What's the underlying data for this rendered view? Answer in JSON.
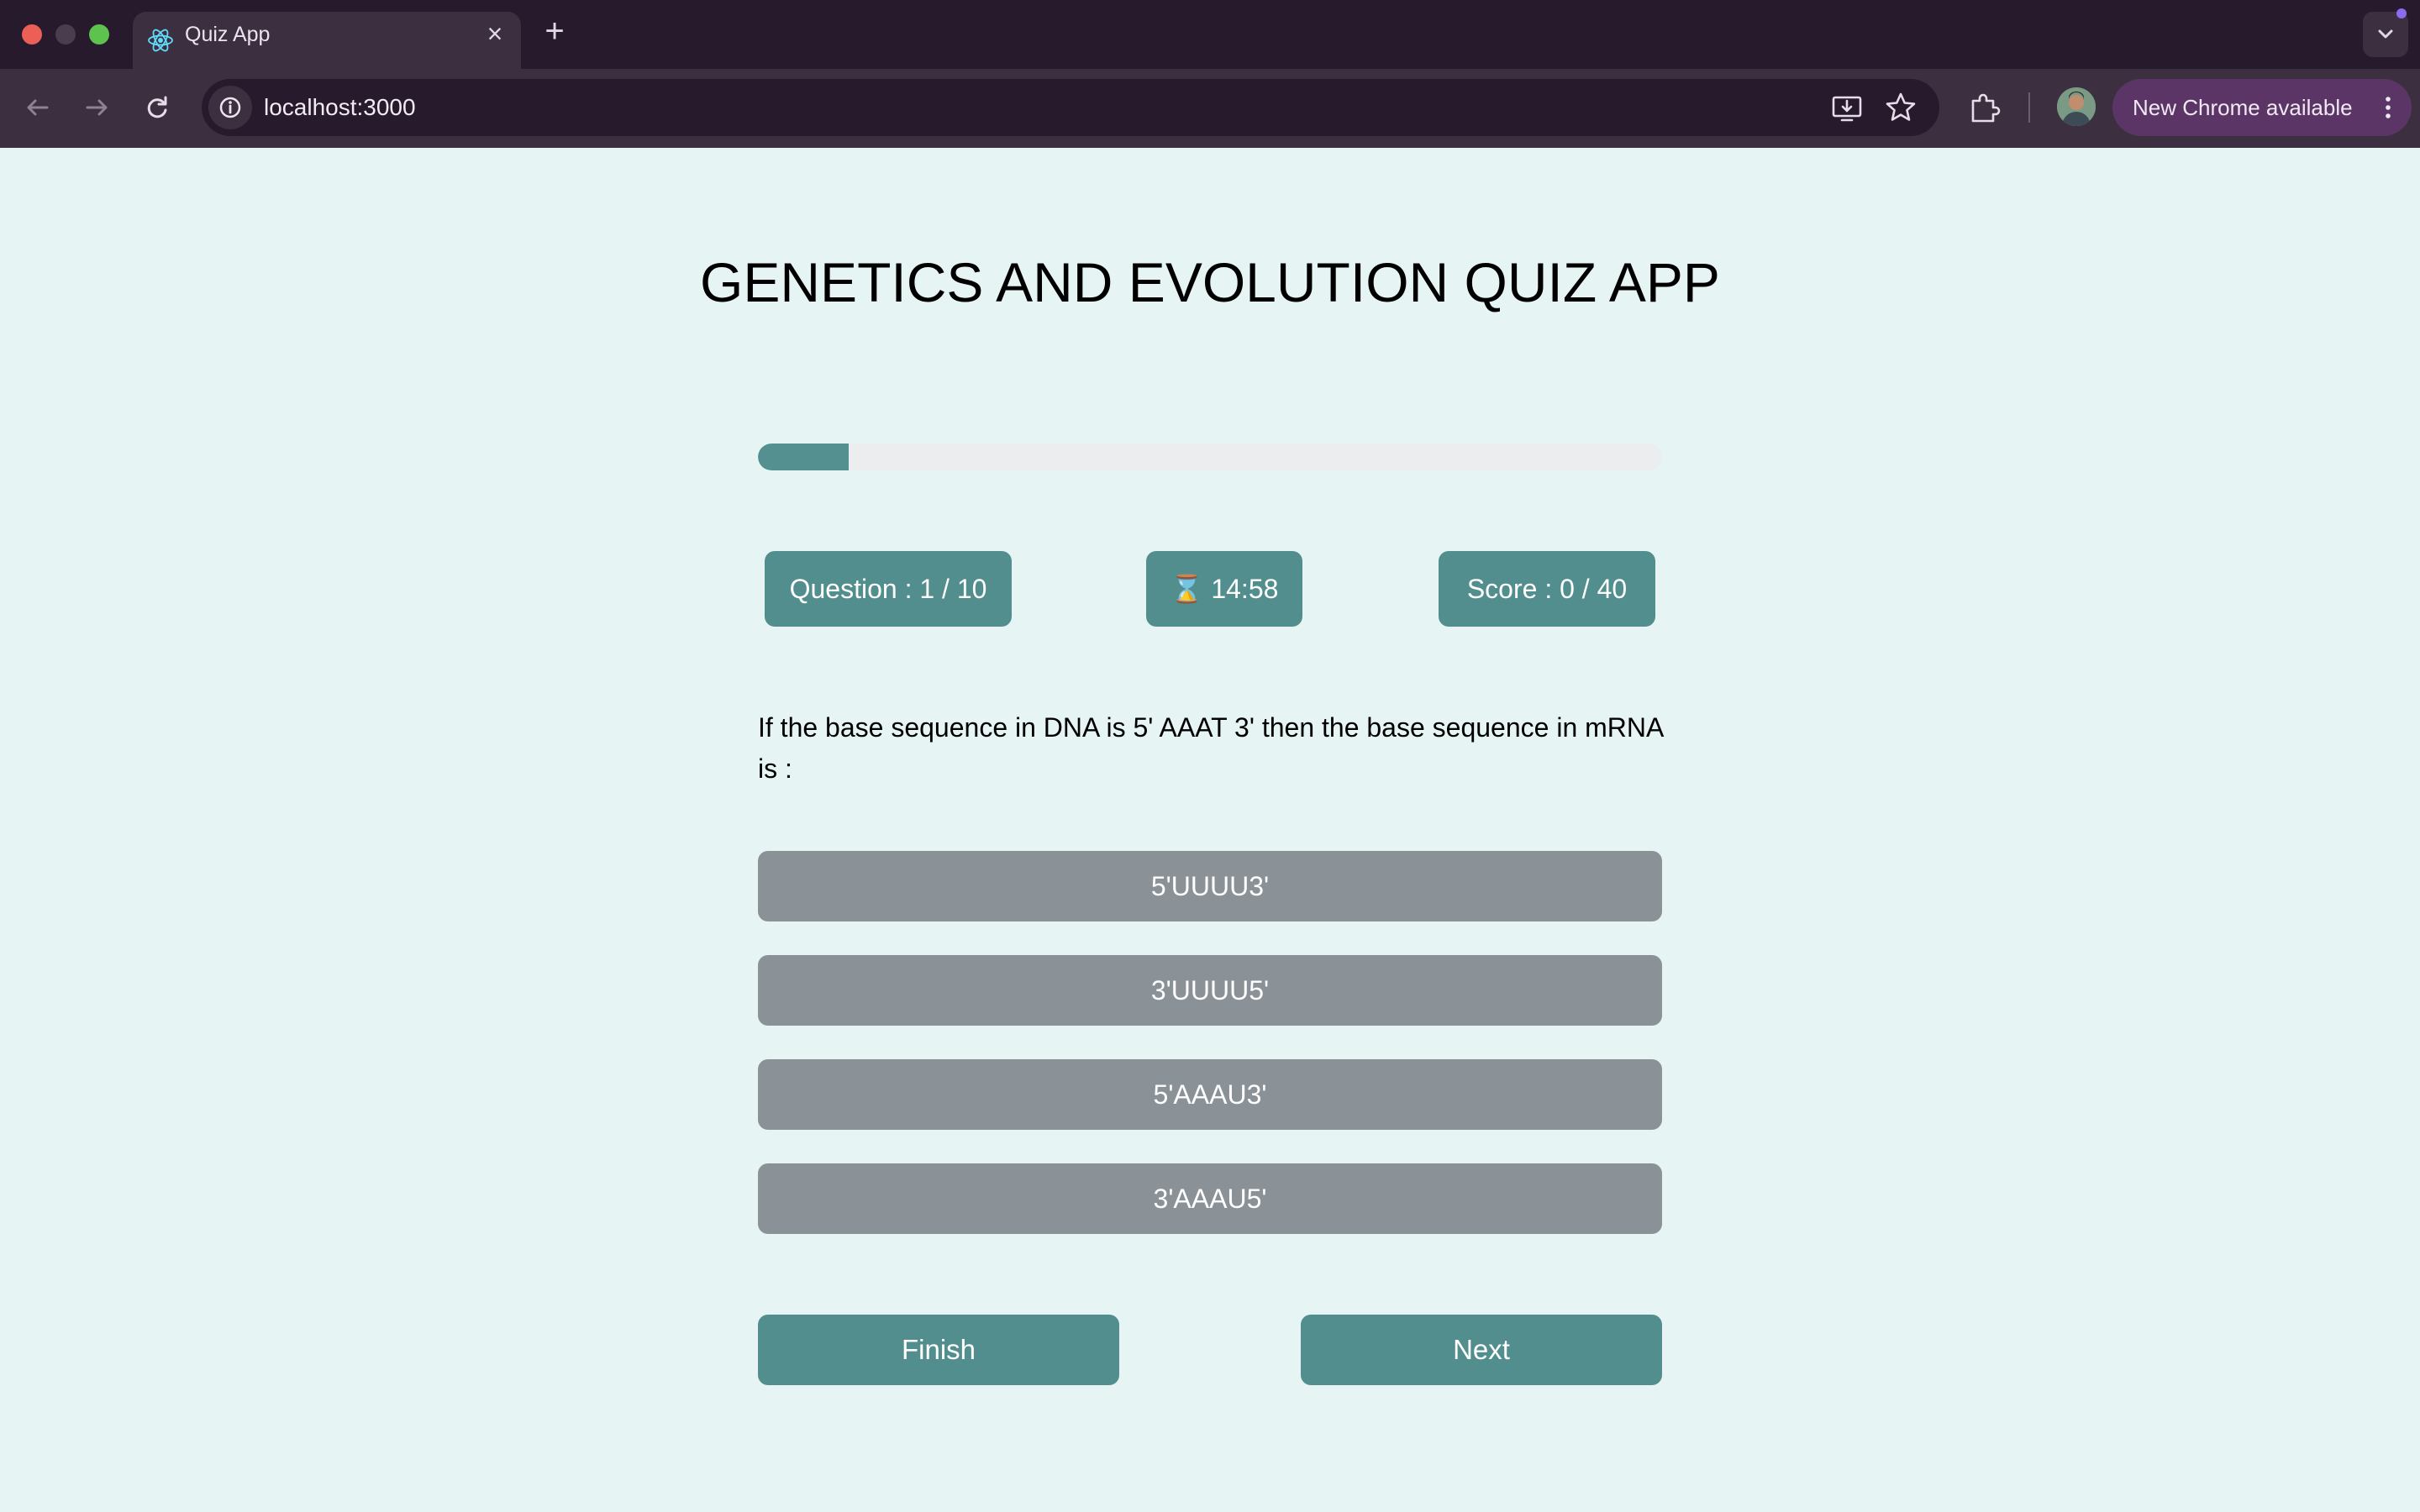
{
  "browser": {
    "tab_title": "Quiz App",
    "url": "localhost:3000",
    "update_label": "New Chrome available",
    "icons": {
      "favicon": "react-logo-icon",
      "tab_close": "close-icon",
      "new_tab": "plus-icon",
      "tab_search": "chevron-down-icon",
      "back": "back-arrow-icon",
      "forward": "forward-arrow-icon",
      "reload": "reload-icon",
      "site_info": "info-icon",
      "install": "install-app-icon",
      "bookmark": "star-icon",
      "extensions": "puzzle-icon",
      "menu": "kebab-menu-icon"
    }
  },
  "quiz": {
    "title": "GENETICS AND EVOLUTION QUIZ APP",
    "progress_fraction": 0.1,
    "question_counter": "Question : 1 / 10",
    "timer": "⌛ 14:58",
    "score": "Score : 0 / 40",
    "question_text": "If the base sequence in DNA is 5' AAAT 3' then the base sequence in mRNA is :",
    "options": [
      "5'UUUU3'",
      "3'UUUU5'",
      "5'AAAU3'",
      "3'AAAU5'"
    ],
    "finish_label": "Finish",
    "next_label": "Next"
  },
  "colors": {
    "page_bg": "#e6f4f4",
    "accent": "#528e8e",
    "option_bg": "#8a9197",
    "progress_track": "#ebedee"
  }
}
